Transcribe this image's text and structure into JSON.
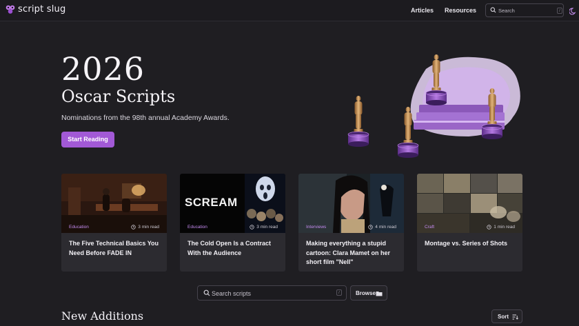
{
  "header": {
    "logo_text": "script slug",
    "nav": [
      "Articles",
      "Resources"
    ],
    "search": {
      "placeholder": "Search",
      "shortcut": "/"
    },
    "icons": [
      "logo-icon",
      "search-icon",
      "moon-icon"
    ]
  },
  "hero": {
    "year": "2026",
    "title": "Oscar Scripts",
    "subtitle": "Nominations from the 98th annual Academy Awards.",
    "cta": "Start Reading"
  },
  "cards": [
    {
      "category": "Education",
      "read_time": "3 min read",
      "title": "The Five Technical Basics You Need Before FADE IN"
    },
    {
      "category": "Education",
      "read_time": "3 min read",
      "title": "The Cold Open Is a Contract With the Audience",
      "poster_text": "SCREAM"
    },
    {
      "category": "Interviews",
      "read_time": "4 min read",
      "title": "Making everything a stupid cartoon: Clara Mamet on her short film \"Nell\""
    },
    {
      "category": "Craft",
      "read_time": "1 min read",
      "title": "Montage vs. Series of Shots"
    }
  ],
  "script_search": {
    "placeholder": "Search scripts",
    "shortcut": "/"
  },
  "browse_label": "Browse",
  "new_additions": {
    "title": "New Additions",
    "sort_label": "Sort"
  },
  "colors": {
    "accent": "#a259d6",
    "category": "#c58bf0",
    "background": "#1f1e22",
    "card": "#2c2b30"
  }
}
